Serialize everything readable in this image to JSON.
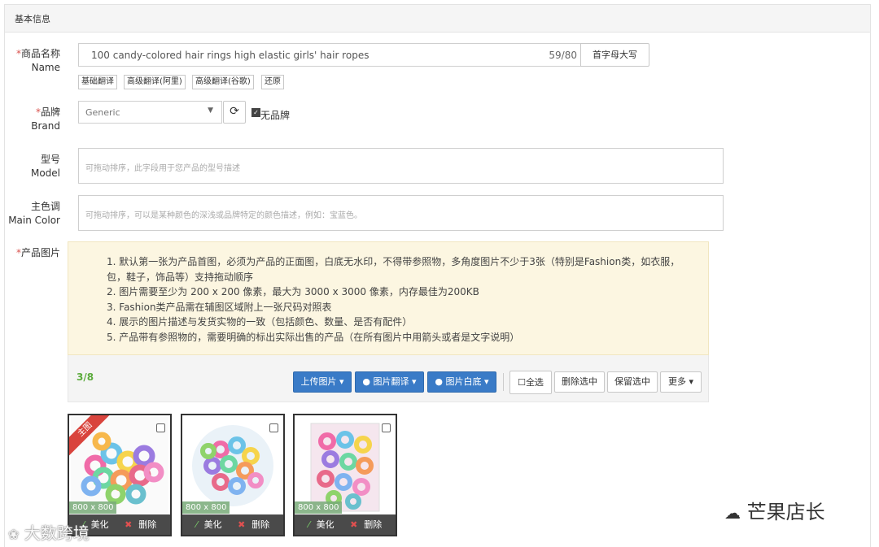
{
  "section_title": "基本信息",
  "name_field": {
    "label_cn": "商品名称",
    "label_en": "Name",
    "value": "100 candy-colored hair rings high elastic girls' hair ropes",
    "counter": "59/80",
    "capitalize_button": "首字母大写",
    "translate_buttons": [
      "基础翻译",
      "高级翻译(阿里)",
      "高级翻译(谷歌)",
      "还原"
    ]
  },
  "brand_field": {
    "label_cn": "品牌",
    "label_en": "Brand",
    "value": "Generic",
    "no_brand_label": "无品牌",
    "no_brand_checked": true
  },
  "model_field": {
    "label_cn": "型号",
    "label_en": "Model",
    "placeholder": "可拖动排序，此字段用于您产品的型号描述"
  },
  "color_field": {
    "label_cn": "主色调",
    "label_en": "Main Color",
    "placeholder": "可拖动排序，可以是某种颜色的深浅或品牌特定的颜色描述，例如：宝蓝色。"
  },
  "images": {
    "label_cn": "产品图片",
    "notice": [
      "1. 默认第一张为产品首图，必须为产品的正面图，白底无水印，不得带参照物，多角度图片不少于3张（特别是Fashion类，如衣服，",
      "包，鞋子，饰品等）支持拖动顺序",
      "2. 图片需要至少为 200 x 200 像素，最大为 3000 x 3000 像素，内存最佳为200KB",
      "3. Fashion类产品需在辅图区域附上一张尺码对照表",
      "4. 展示的图片描述与发货实物的一致（包括颜色、数量、是否有配件）",
      "5. 产品带有参照物的，需要明确的标出实际出售的产品（在所有图片中用箭头或者是文字说明）"
    ],
    "count": "3/8",
    "upload_button": "上传图片",
    "translate_button": "图片翻译",
    "whiten_button": "图片白底",
    "select_all_label": "全选",
    "delete_selected_button": "删除选中",
    "keep_selected_button": "保留选中",
    "more_button": "更多",
    "main_ribbon": "主图",
    "thumbnails": [
      {
        "size": "800 x 800",
        "beautify": "美化",
        "delete": "删除"
      },
      {
        "size": "800 x 800",
        "beautify": "美化",
        "delete": "删除"
      },
      {
        "size": "800 x 800",
        "beautify": "美化",
        "delete": "删除"
      }
    ]
  },
  "watermarks": {
    "left": "大数跨境",
    "right": "芒果店长"
  }
}
